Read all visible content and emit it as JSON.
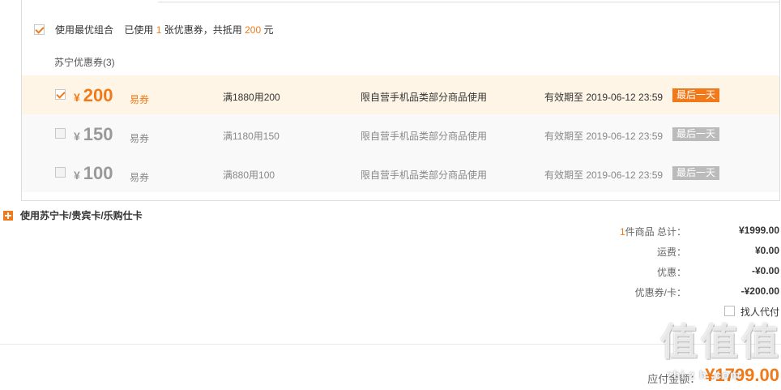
{
  "best_combo": {
    "checked": true,
    "label": "使用最优组合",
    "prefix": "已使用",
    "count": "1",
    "middle": "张优惠券，共抵用",
    "amount": "200",
    "unit": "元"
  },
  "section_title": "苏宁优惠券(3)",
  "coupons": [
    {
      "selected": true,
      "yen": "¥",
      "amount": "200",
      "type": "易券",
      "condition": "满1880用200",
      "scope": "限自营手机品类部分商品使用",
      "expiry": "有效期至 2019-06-12 23:59",
      "badge": "最后一天"
    },
    {
      "selected": false,
      "yen": "¥",
      "amount": "150",
      "type": "易券",
      "condition": "满1180用150",
      "scope": "限自营手机品类部分商品使用",
      "expiry": "有效期至 2019-06-12 23:59",
      "badge": "最后一天"
    },
    {
      "selected": false,
      "yen": "¥",
      "amount": "100",
      "type": "易券",
      "condition": "满880用100",
      "scope": "限自营手机品类部分商品使用",
      "expiry": "有效期至 2019-06-12 23:59",
      "badge": "最后一天"
    }
  ],
  "cards_toggle": {
    "label": "使用苏宁卡/贵宾卡/乐购仕卡"
  },
  "summary": {
    "items_count": "1",
    "items_label": "件商品  总计：",
    "total": "¥1999.00",
    "shipping_label": "运费：",
    "shipping": "¥0.00",
    "discount_label": "优惠：",
    "discount": "-¥0.00",
    "coupon_label": "优惠券/卡：",
    "coupon": "-¥200.00"
  },
  "proxy_pay": {
    "label": "找人代付",
    "checked": false
  },
  "payable": {
    "label": "应付金额：",
    "value": "¥1799.00"
  },
  "watermark": {
    "glyph": "值",
    "domain": "zhi z h  .com"
  },
  "colors": {
    "accent": "#f07a1a",
    "selected_row_bg": "#fff5e6",
    "disabled_badge": "#bbbbbb"
  }
}
